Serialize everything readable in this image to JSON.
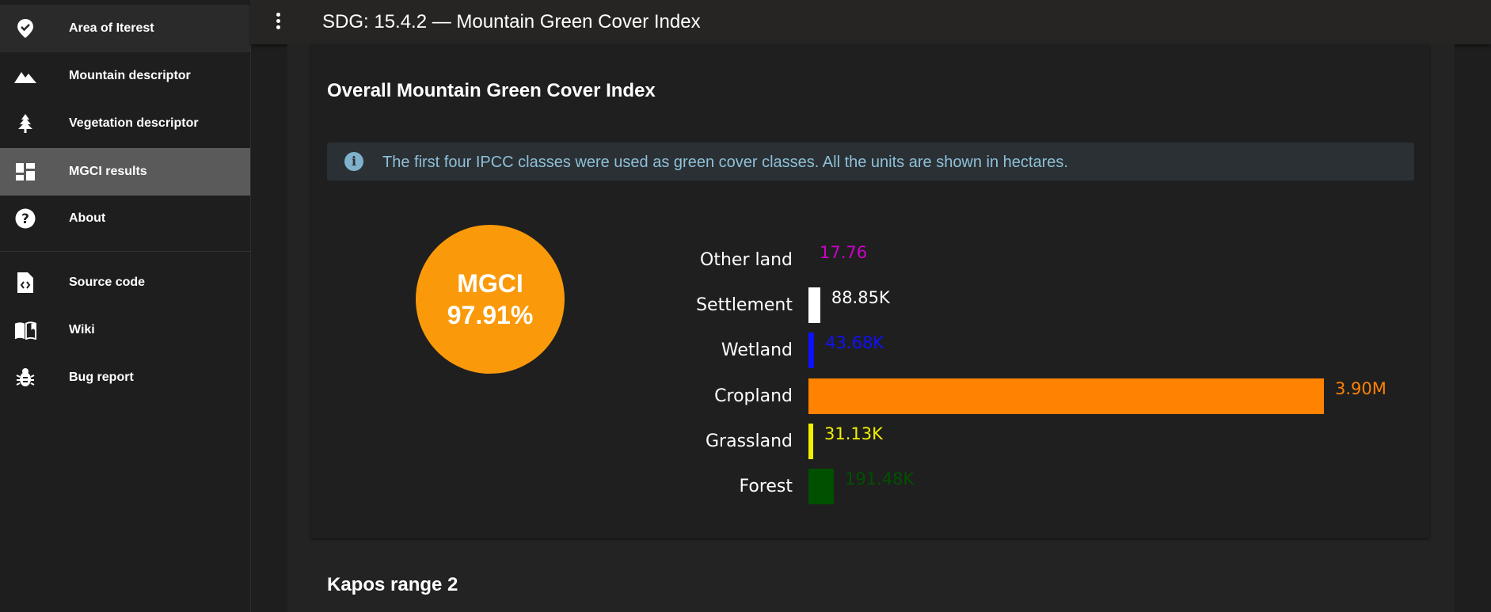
{
  "sidebar": {
    "items": [
      {
        "label": "Area of Iterest",
        "icon": "map-marker-check-icon"
      },
      {
        "label": "Mountain descriptor",
        "icon": "mountain-icon"
      },
      {
        "label": "Vegetation descriptor",
        "icon": "pine-tree-icon"
      },
      {
        "label": "MGCI results",
        "icon": "dashboard-icon"
      },
      {
        "label": "About",
        "icon": "help-circle-icon"
      },
      {
        "label": "Source code",
        "icon": "file-code-icon"
      },
      {
        "label": "Wiki",
        "icon": "book-open-icon"
      },
      {
        "label": "Bug report",
        "icon": "bug-icon"
      }
    ]
  },
  "topbar": {
    "title": "SDG: 15.4.2 — Mountain Green Cover Index"
  },
  "card": {
    "title": "Overall Mountain Green Cover Index",
    "info": "The first four IPCC classes were used as green cover classes. All the units are shown in hectares.",
    "mgci_label": "MGCI",
    "mgci_value": "97.91%"
  },
  "chart_data": {
    "type": "bar",
    "orientation": "horizontal",
    "categories": [
      "Other land",
      "Settlement",
      "Wetland",
      "Cropland",
      "Grassland",
      "Forest"
    ],
    "values": [
      17.76,
      88850,
      43680,
      3900000,
      31130,
      191480
    ],
    "value_labels": [
      "17.76",
      "88.85K",
      "43.68K",
      "3.90M",
      "31.13K",
      "191.48K"
    ],
    "colors": [
      "#cc00cc",
      "#ffffff",
      "#1010ff",
      "#ff8200",
      "#f0f000",
      "#005000"
    ]
  },
  "section2": {
    "title": "Kapos range 2"
  }
}
